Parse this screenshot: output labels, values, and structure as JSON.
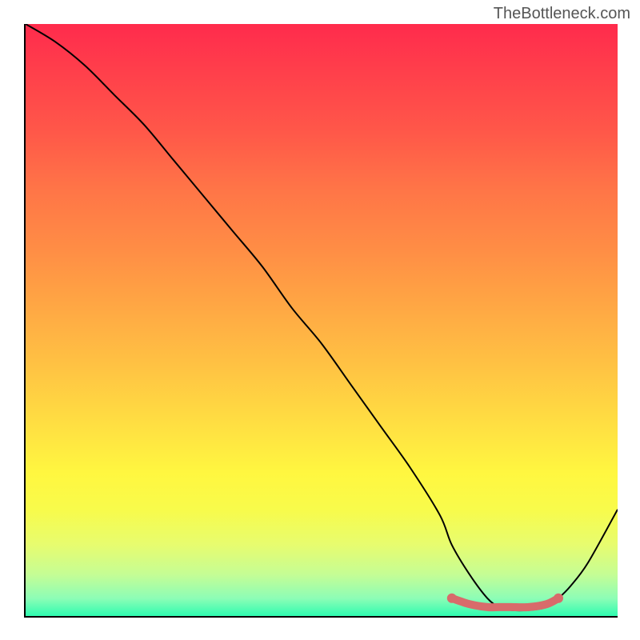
{
  "watermark": "TheBottleneck.com",
  "chart_data": {
    "type": "line",
    "title": "",
    "xlabel": "",
    "ylabel": "",
    "xlim": [
      0,
      100
    ],
    "ylim": [
      0,
      100
    ],
    "series": [
      {
        "name": "main-curve",
        "color": "#000000",
        "x": [
          0,
          5,
          10,
          15,
          20,
          25,
          30,
          35,
          40,
          45,
          50,
          55,
          60,
          65,
          70,
          72,
          75,
          78,
          80,
          82,
          85,
          88,
          90,
          92,
          95,
          100
        ],
        "y": [
          100,
          97,
          93,
          88,
          83,
          77,
          71,
          65,
          59,
          52,
          46,
          39,
          32,
          25,
          17,
          12,
          7,
          3,
          1.5,
          1,
          1,
          1.5,
          3,
          5,
          9,
          18
        ]
      },
      {
        "name": "marker-band",
        "color": "#d86b6b",
        "x": [
          72,
          75,
          78,
          80,
          82,
          85,
          88,
          90
        ],
        "y": [
          3,
          2,
          1.5,
          1.5,
          1.5,
          1.5,
          2,
          3
        ]
      }
    ]
  }
}
